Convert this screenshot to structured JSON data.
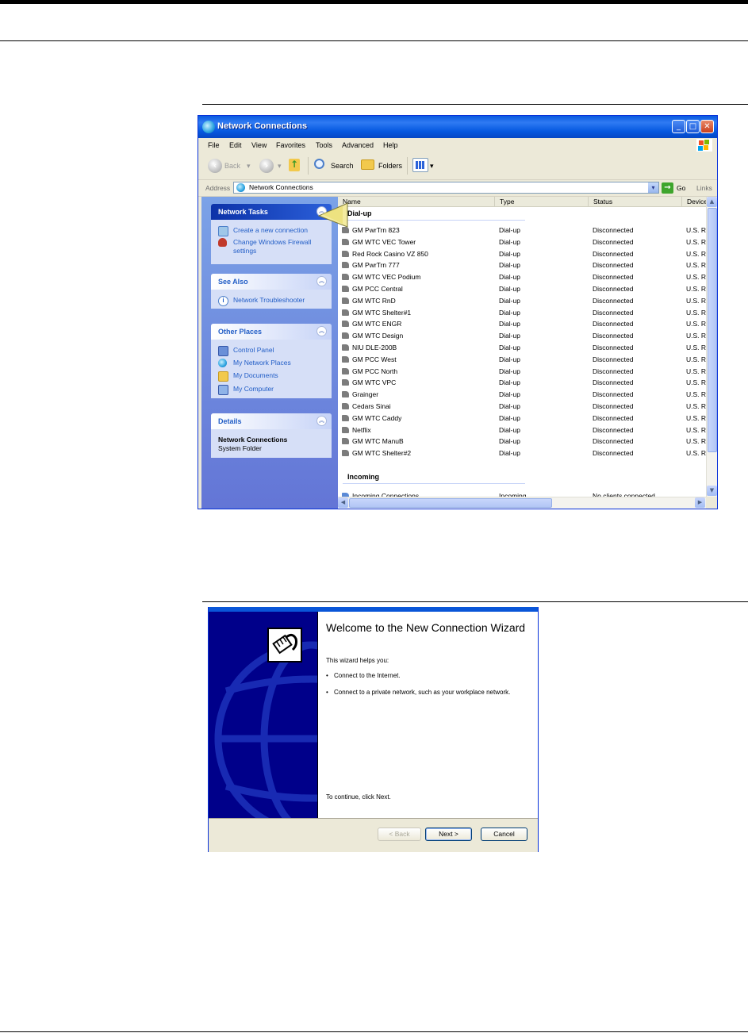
{
  "explorer": {
    "title": "Network Connections",
    "menu": [
      "File",
      "Edit",
      "View",
      "Favorites",
      "Tools",
      "Advanced",
      "Help"
    ],
    "toolbar": {
      "back": "Back",
      "search": "Search",
      "folders": "Folders"
    },
    "address": {
      "label": "Address",
      "value": "Network Connections",
      "go": "Go",
      "links": "Links"
    },
    "panels": {
      "network_tasks": {
        "title": "Network Tasks",
        "items": [
          "Create a new connection",
          "Change Windows Firewall",
          "settings"
        ]
      },
      "see_also": {
        "title": "See Also",
        "items": [
          "Network Troubleshooter"
        ]
      },
      "other_places": {
        "title": "Other Places",
        "items": [
          "Control Panel",
          "My Network Places",
          "My Documents",
          "My Computer"
        ]
      },
      "details": {
        "title": "Details",
        "name": "Network Connections",
        "type": "System Folder"
      }
    },
    "columns": [
      "Name",
      "Type",
      "Status",
      "Device"
    ],
    "groups": {
      "dialup": "Dial-up",
      "incoming": "Incoming"
    },
    "rows": [
      {
        "name": "GM PwrTrn 823",
        "type": "Dial-up",
        "status": "Disconnected",
        "device": "U.S. R"
      },
      {
        "name": "GM WTC VEC Tower",
        "type": "Dial-up",
        "status": "Disconnected",
        "device": "U.S. R"
      },
      {
        "name": "Red Rock Casino VZ 850",
        "type": "Dial-up",
        "status": "Disconnected",
        "device": "U.S. R"
      },
      {
        "name": "GM PwrTrn 777",
        "type": "Dial-up",
        "status": "Disconnected",
        "device": "U.S. R"
      },
      {
        "name": "GM WTC VEC Podium",
        "type": "Dial-up",
        "status": "Disconnected",
        "device": "U.S. R"
      },
      {
        "name": "GM PCC Central",
        "type": "Dial-up",
        "status": "Disconnected",
        "device": "U.S. R"
      },
      {
        "name": "GM WTC RnD",
        "type": "Dial-up",
        "status": "Disconnected",
        "device": "U.S. R"
      },
      {
        "name": "GM WTC Shelter#1",
        "type": "Dial-up",
        "status": "Disconnected",
        "device": "U.S. R"
      },
      {
        "name": "GM WTC ENGR",
        "type": "Dial-up",
        "status": "Disconnected",
        "device": "U.S. R"
      },
      {
        "name": "GM WTC Design",
        "type": "Dial-up",
        "status": "Disconnected",
        "device": "U.S. R"
      },
      {
        "name": "NIU DLE-200B",
        "type": "Dial-up",
        "status": "Disconnected",
        "device": "U.S. R"
      },
      {
        "name": "GM PCC West",
        "type": "Dial-up",
        "status": "Disconnected",
        "device": "U.S. R"
      },
      {
        "name": "GM PCC North",
        "type": "Dial-up",
        "status": "Disconnected",
        "device": "U.S. R"
      },
      {
        "name": "GM WTC VPC",
        "type": "Dial-up",
        "status": "Disconnected",
        "device": "U.S. R"
      },
      {
        "name": "Grainger",
        "type": "Dial-up",
        "status": "Disconnected",
        "device": "U.S. R"
      },
      {
        "name": "Cedars Sinai",
        "type": "Dial-up",
        "status": "Disconnected",
        "device": "U.S. R"
      },
      {
        "name": "GM WTC Caddy",
        "type": "Dial-up",
        "status": "Disconnected",
        "device": "U.S. R"
      },
      {
        "name": "Netflix",
        "type": "Dial-up",
        "status": "Disconnected",
        "device": "U.S. R"
      },
      {
        "name": "GM WTC ManuB",
        "type": "Dial-up",
        "status": "Disconnected",
        "device": "U.S. R"
      },
      {
        "name": "GM WTC Shelter#2",
        "type": "Dial-up",
        "status": "Disconnected",
        "device": "U.S. R"
      }
    ],
    "incoming_row": {
      "name": "Incoming Connections",
      "type": "Incoming",
      "status": "No clients connected"
    }
  },
  "wizard": {
    "heading": "Welcome to the New Connection Wizard",
    "intro": "This wizard helps you:",
    "bullets": [
      "Connect to the Internet.",
      "Connect to a private network, such as your workplace network."
    ],
    "continue": "To continue, click Next.",
    "buttons": {
      "back": "< Back",
      "next": "Next >",
      "cancel": "Cancel"
    }
  },
  "colors": {
    "xp_blue": "#0a5bdf",
    "task_pane": "#6375d6",
    "link": "#215dc6",
    "wizard_side": "#00008a"
  }
}
